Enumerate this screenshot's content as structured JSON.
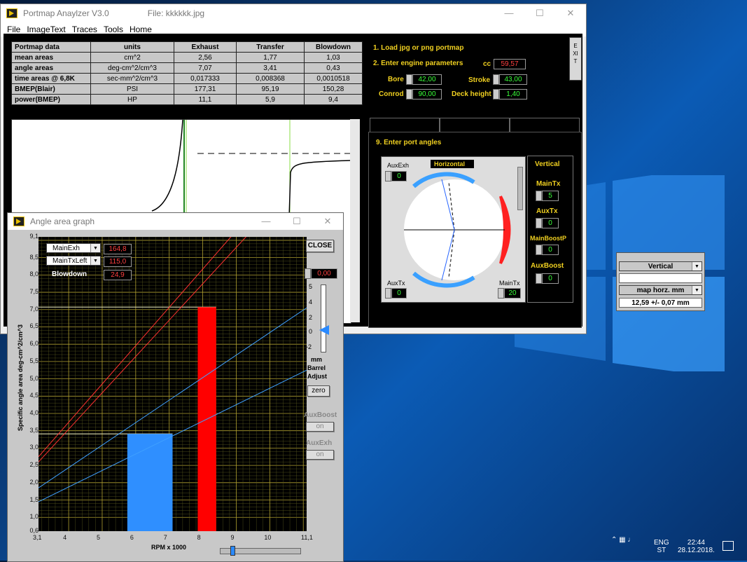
{
  "main_window": {
    "title": "Portmap Anaylzer V3.0",
    "file": "File: kkkkkk.jpg",
    "menu": [
      "File",
      "ImageText",
      "Traces",
      "Tools",
      "Home"
    ],
    "table": {
      "headers": [
        "Portmap data",
        "units",
        "Exhaust",
        "Transfer",
        "Blowdown"
      ],
      "rows": [
        [
          "mean areas",
          "cm^2",
          "2,56",
          "1,77",
          "1,03"
        ],
        [
          "angle areas",
          "deg-cm^2/cm^3",
          "7,07",
          "3,41",
          "0,43"
        ],
        [
          "time areas @ 6,8K",
          "sec-mm^2/cm^3",
          "0,017333",
          "0,008368",
          "0,0010518"
        ],
        [
          "BMEP(Blair)",
          "PSI",
          "177,31",
          "95,19",
          "150,28"
        ],
        [
          "power(BMEP)",
          "HP",
          "11,1",
          "5,9",
          "9,4"
        ]
      ]
    },
    "steps": {
      "s1": "1. Load jpg or png portmap",
      "s2": "2. Enter engine parameters",
      "s9": "9. Enter port angles"
    },
    "params": {
      "cc_label": "cc",
      "cc": "59,57",
      "bore_label": "Bore",
      "bore": "42,00",
      "stroke_label": "Stroke",
      "stroke": "43,00",
      "conrod_label": "Conrod",
      "conrod": "90,00",
      "deck_label": "Deck height",
      "deck": "1,40"
    },
    "exit_label": "EXIT",
    "ports": {
      "horizontal": "Horizontal",
      "auxexh_label": "AuxExh",
      "auxexh": "0",
      "auxtx_label": "AuxTx",
      "auxtx": "0",
      "maintx_label": "MainTx",
      "maintx": "20",
      "vertical": "Vertical",
      "v_maintx_label": "MainTx",
      "v_maintx": "5",
      "v_auxtx_label": "AuxTx",
      "v_auxtx": "0",
      "v_mainboost_label": "MainBoostP",
      "v_mainboost": "0",
      "v_auxboost_label": "AuxBoost",
      "v_auxboost": "0"
    }
  },
  "angle_window": {
    "title": "Angle area graph",
    "close": "CLOSE",
    "dd1": "MainExh",
    "dd1_val": "164,8",
    "dd2": "MainTxLeft",
    "dd2_val": "115,0",
    "blowdown_label": "Blowdown",
    "blowdown_val": "24,9",
    "barrel_val": "0,00",
    "barrel_ticks": [
      "5",
      "4",
      "2",
      "0",
      "-2"
    ],
    "barrel_label1": "mm",
    "barrel_label2": "Barrel",
    "barrel_label3": "Adjust",
    "zero": "zero",
    "auxboost": "AuxBoost",
    "auxboost_btn": "on",
    "auxexh": "AuxExh",
    "auxexh_btn": "on"
  },
  "chart_data": {
    "type": "bar",
    "xlabel": "RPM x 1000",
    "ylabel": "Specific angle area  deg-cm^2/cm^3",
    "xlim": [
      3.1,
      11.1
    ],
    "ylim": [
      0.6,
      9.1
    ],
    "xticks": [
      "3,1",
      "4",
      "5",
      "6",
      "7",
      "8",
      "9",
      "10",
      "11,1"
    ],
    "yticks": [
      "9,1",
      "8,5",
      "8,0",
      "7,5",
      "7,0",
      "6,5",
      "6,0",
      "5,5",
      "5,0",
      "4,5",
      "4,0",
      "3,5",
      "3,0",
      "2,5",
      "2,0",
      "1,5",
      "1,0",
      "0,6"
    ],
    "bars": [
      {
        "x0": 5.75,
        "x1": 7.1,
        "value": 3.41,
        "color": "#2f8fff"
      },
      {
        "x0": 7.85,
        "x1": 8.4,
        "value": 7.07,
        "color": "#ff0000"
      }
    ],
    "lines": [
      {
        "color": "#ff3030",
        "points": [
          [
            3.1,
            2.75
          ],
          [
            11.1,
            11.6
          ]
        ]
      },
      {
        "color": "#ff3030",
        "points": [
          [
            3.1,
            2.6
          ],
          [
            11.1,
            11.0
          ]
        ]
      },
      {
        "color": "#3fa0ff",
        "points": [
          [
            3.1,
            1.85
          ],
          [
            11.1,
            7.05
          ]
        ]
      },
      {
        "color": "#3fa0ff",
        "points": [
          [
            3.1,
            1.45
          ],
          [
            11.1,
            5.25
          ]
        ]
      }
    ],
    "hlines": [
      {
        "y": 7.07
      },
      {
        "y": 3.41
      }
    ],
    "grid": true
  },
  "vertical_widget": {
    "select1": "Vertical",
    "select2": "map horz. mm",
    "readout": "12,59 +/- 0,07 mm"
  },
  "taskbar": {
    "lang1": "ENG",
    "lang2": "ST",
    "time": "22:44",
    "date": "28.12.2018."
  }
}
